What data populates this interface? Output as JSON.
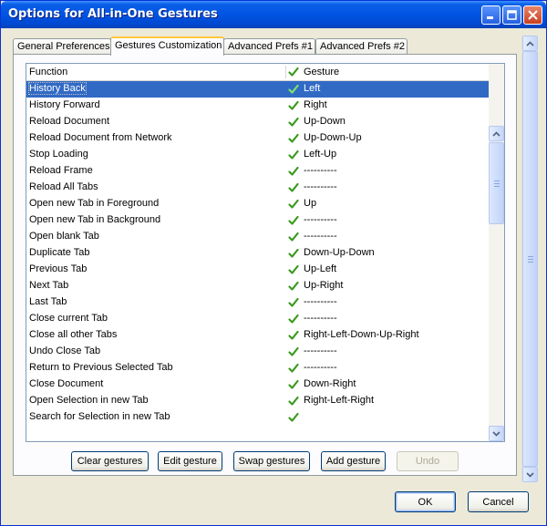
{
  "window": {
    "title": "Options for All-in-One Gestures",
    "buttons": {
      "minimize": "minimize",
      "maximize": "maximize",
      "close": "close"
    }
  },
  "tabs": [
    {
      "label": "General Preferences",
      "active": false
    },
    {
      "label": "Gestures Customization",
      "active": true
    },
    {
      "label": "Advanced Prefs #1",
      "active": false
    },
    {
      "label": "Advanced Prefs #2",
      "active": false
    }
  ],
  "list": {
    "columns": {
      "function": "Function",
      "gesture": "Gesture"
    },
    "rows": [
      {
        "function": "History Back",
        "gesture": "Left",
        "selected": true
      },
      {
        "function": "History Forward",
        "gesture": "Right"
      },
      {
        "function": "Reload Document",
        "gesture": "Up-Down"
      },
      {
        "function": "Reload Document from Network",
        "gesture": "Up-Down-Up"
      },
      {
        "function": "Stop Loading",
        "gesture": "Left-Up"
      },
      {
        "function": "Reload Frame",
        "gesture": "----------"
      },
      {
        "function": "Reload All Tabs",
        "gesture": "----------"
      },
      {
        "function": "Open new Tab in Foreground",
        "gesture": "Up"
      },
      {
        "function": "Open new Tab in Background",
        "gesture": "----------"
      },
      {
        "function": "Open blank Tab",
        "gesture": "----------"
      },
      {
        "function": "Duplicate Tab",
        "gesture": "Down-Up-Down"
      },
      {
        "function": "Previous Tab",
        "gesture": "Up-Left"
      },
      {
        "function": "Next Tab",
        "gesture": "Up-Right"
      },
      {
        "function": "Last Tab",
        "gesture": "----------"
      },
      {
        "function": "Close current Tab",
        "gesture": "----------"
      },
      {
        "function": "Close all other Tabs",
        "gesture": "Right-Left-Down-Up-Right"
      },
      {
        "function": "Undo Close Tab",
        "gesture": "----------"
      },
      {
        "function": "Return to Previous Selected Tab",
        "gesture": "----------"
      },
      {
        "function": "Close Document",
        "gesture": "Down-Right"
      },
      {
        "function": "Open Selection in new Tab",
        "gesture": "Right-Left-Right"
      },
      {
        "function": "Search for Selection in new Tab",
        "gesture": ""
      }
    ]
  },
  "actions": {
    "clear": "Clear gestures",
    "edit": "Edit gesture",
    "swap": "Swap gestures",
    "add": "Add gesture",
    "undo": "Undo"
  },
  "footer": {
    "ok": "OK",
    "cancel": "Cancel"
  },
  "colors": {
    "titlebar": "#0054e3",
    "selection": "#316ac5",
    "checkmark": "#3a9a1e",
    "dialog": "#ece9d8"
  },
  "icons": {
    "check": "check-icon"
  }
}
